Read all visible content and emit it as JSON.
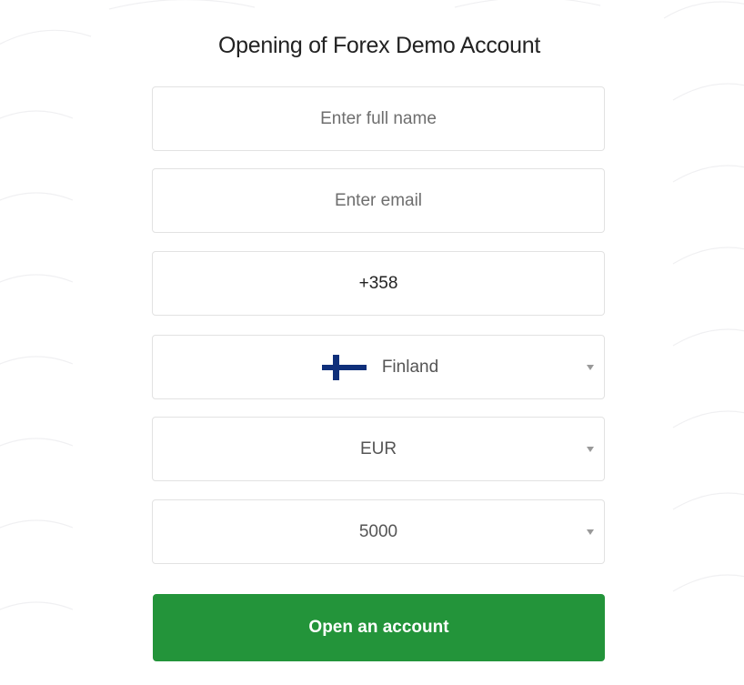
{
  "form": {
    "title": "Opening of Forex Demo Account",
    "full_name": {
      "placeholder": "Enter full name",
      "value": ""
    },
    "email": {
      "placeholder": "Enter email",
      "value": ""
    },
    "phone": {
      "value": "+358"
    },
    "country": {
      "selected": "Finland",
      "flag_icon": "finland-flag-icon"
    },
    "currency": {
      "selected": "EUR"
    },
    "deposit": {
      "selected": "5000"
    },
    "submit_label": "Open an account"
  },
  "colors": {
    "button_green": "#23943a",
    "border": "#e2e2e2",
    "flag_blue": "#0f2f7a",
    "text": "#222222"
  }
}
